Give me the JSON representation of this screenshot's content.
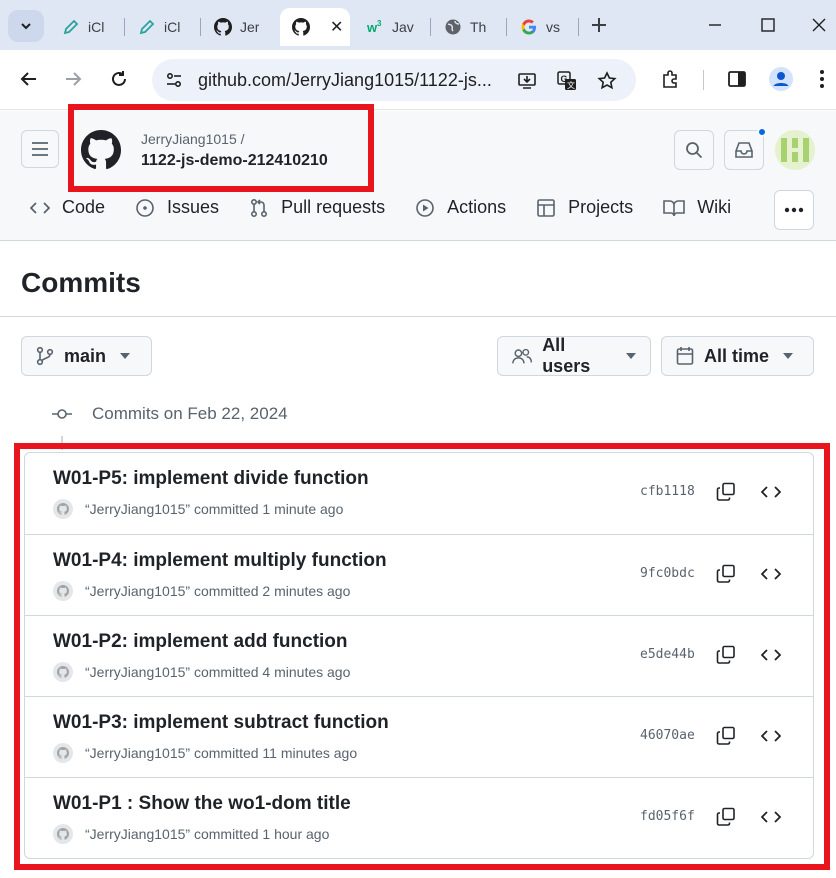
{
  "browser": {
    "tabs": [
      {
        "title": "iCl",
        "favicon": "pen-icon"
      },
      {
        "title": "iCl",
        "favicon": "pen-icon"
      },
      {
        "title": "Jer",
        "favicon": "github-icon"
      },
      {
        "title": "",
        "favicon": "github-icon",
        "active": true
      },
      {
        "title": "Jav",
        "favicon": "w3schools-icon"
      },
      {
        "title": "Th",
        "favicon": "globe-icon"
      },
      {
        "title": "vs",
        "favicon": "google-icon"
      }
    ],
    "url": "github.com/JerryJiang1015/1122-js..."
  },
  "repo": {
    "owner": "JerryJiang1015 /",
    "name": "1122-js-demo-212410210"
  },
  "nav": {
    "items": [
      {
        "label": "Code",
        "icon": "code-icon"
      },
      {
        "label": "Issues",
        "icon": "issue-icon"
      },
      {
        "label": "Pull requests",
        "icon": "pull-request-icon"
      },
      {
        "label": "Actions",
        "icon": "play-icon"
      },
      {
        "label": "Projects",
        "icon": "table-icon"
      },
      {
        "label": "Wiki",
        "icon": "book-icon"
      }
    ]
  },
  "page": {
    "title": "Commits",
    "branch": "main",
    "users_filter": "All users",
    "time_filter": "All time",
    "group_heading": "Commits on Feb 22, 2024"
  },
  "commits": [
    {
      "title": "W01-P5: implement divide function",
      "author": "“JerryJiang1015”",
      "action": "committed",
      "time": "1 minute ago",
      "sha": "cfb1118"
    },
    {
      "title": "W01-P4: implement multiply function",
      "author": "“JerryJiang1015”",
      "action": "committed",
      "time": "2 minutes ago",
      "sha": "9fc0bdc"
    },
    {
      "title": "W01-P2: implement add function",
      "author": "“JerryJiang1015”",
      "action": "committed",
      "time": "4 minutes ago",
      "sha": "e5de44b"
    },
    {
      "title": "W01-P3: implement subtract function",
      "author": "“JerryJiang1015”",
      "action": "committed",
      "time": "11 minutes ago",
      "sha": "46070ae"
    },
    {
      "title": "W01-P1 : Show the wo1-dom title",
      "author": "“JerryJiang1015”",
      "action": "committed",
      "time": "1 hour ago",
      "sha": "fd05f6f"
    }
  ],
  "colors": {
    "highlight": "#e8141e",
    "accent": "#0969da",
    "tabstrip": "#dfe7f5"
  }
}
